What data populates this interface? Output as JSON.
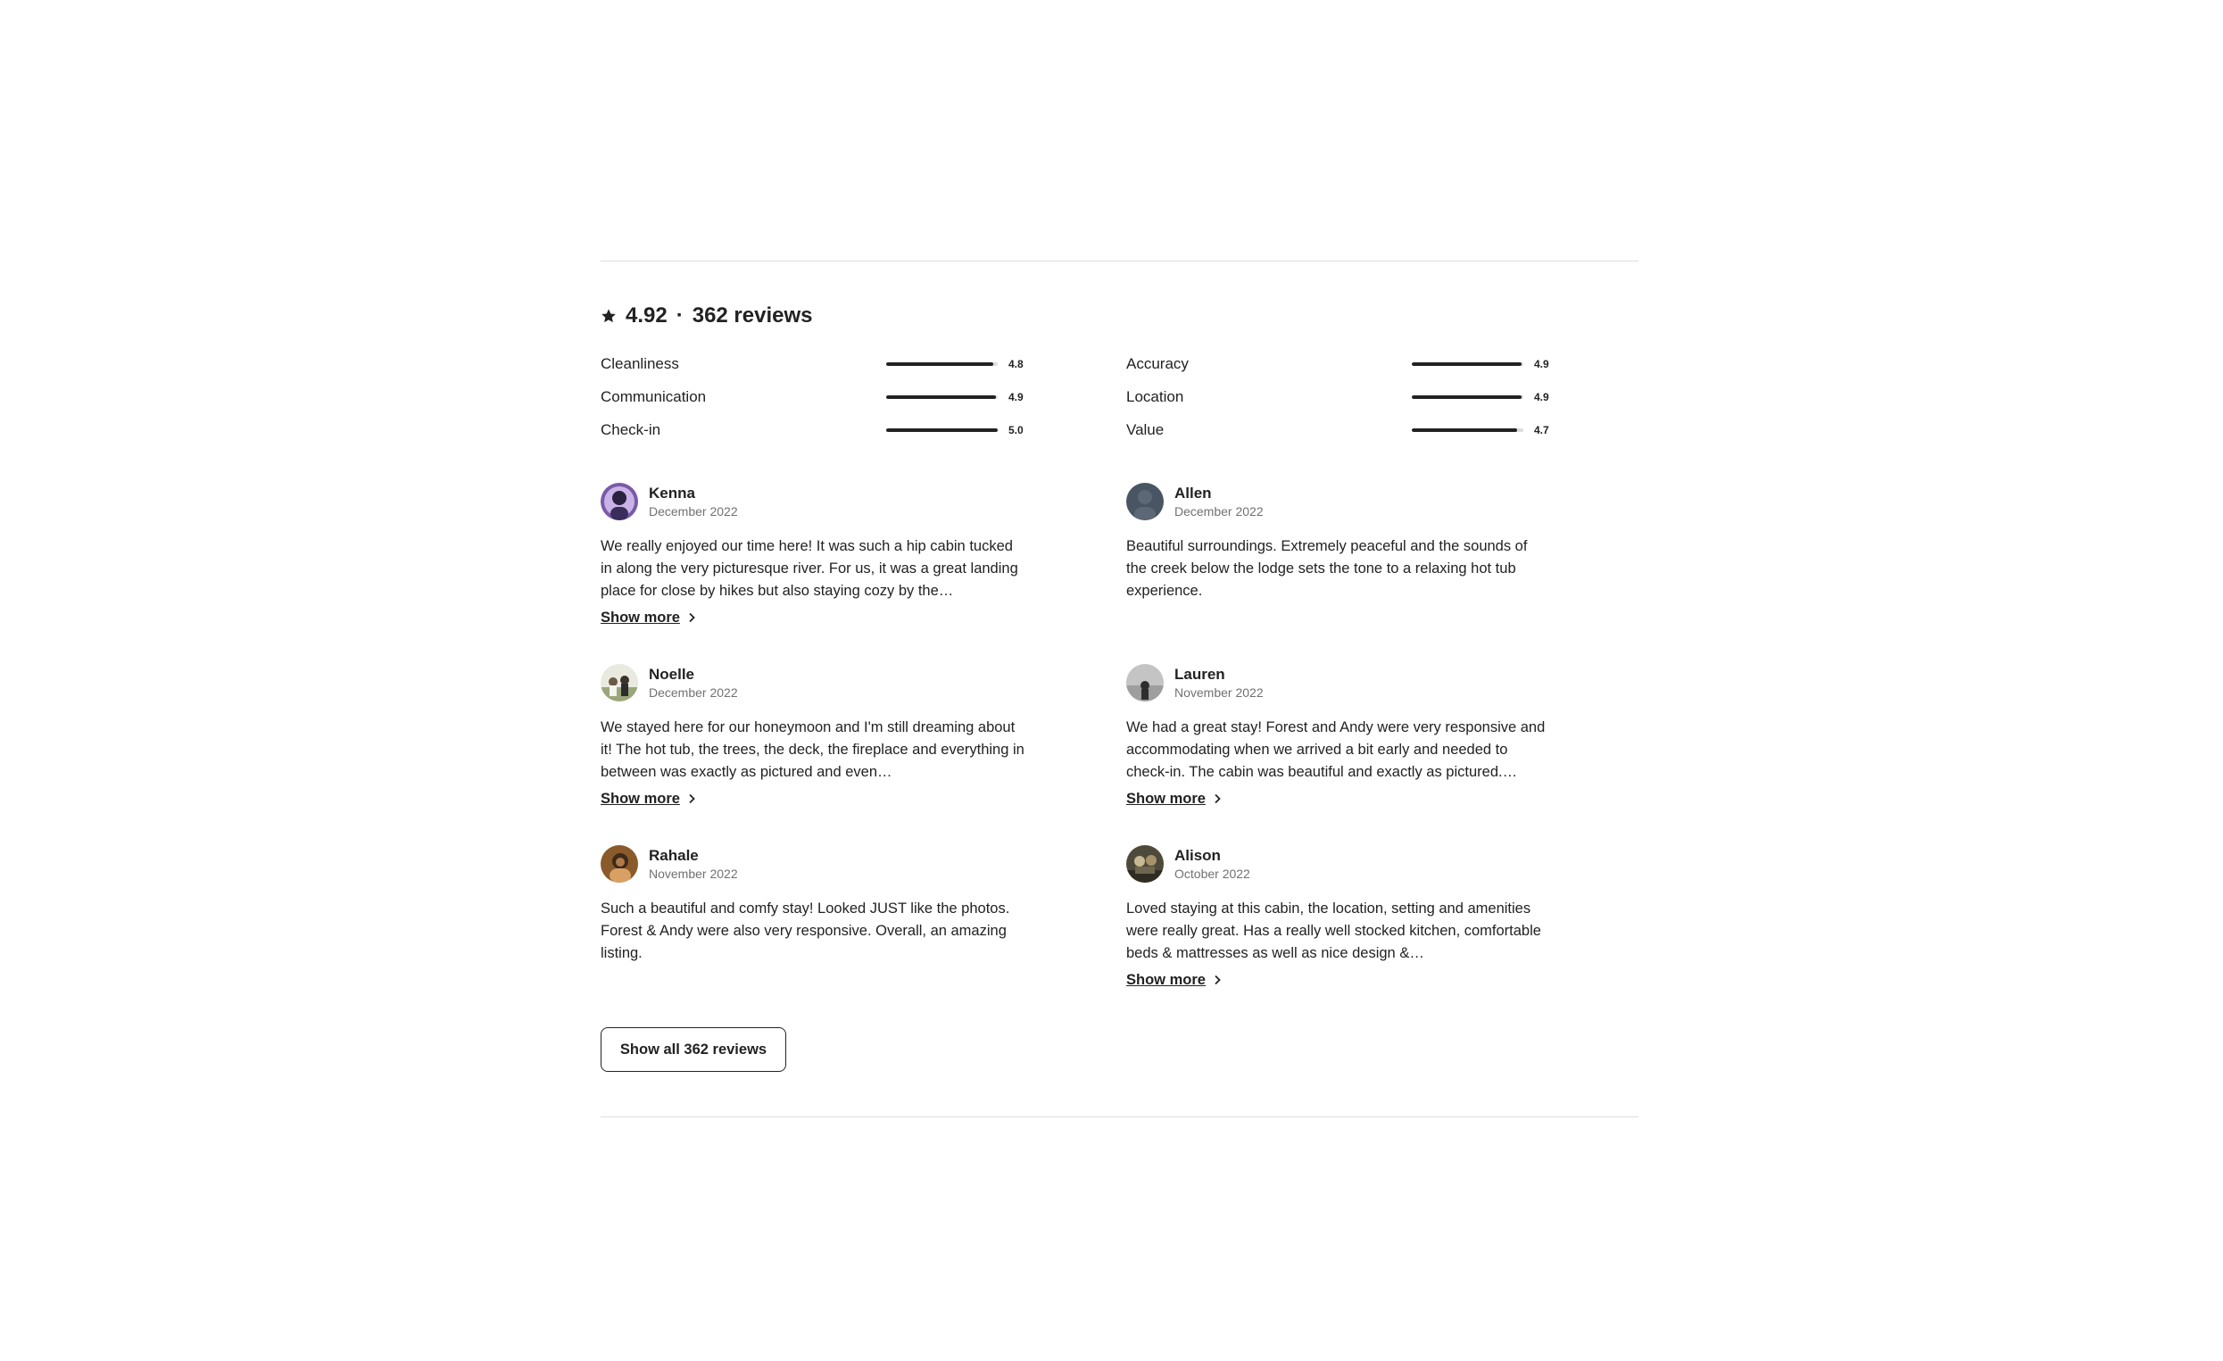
{
  "summary": {
    "rating": "4.92",
    "separator": "·",
    "reviews_label": "362 reviews"
  },
  "ratings": [
    {
      "label": "Cleanliness",
      "value": "4.8",
      "fraction": 0.96
    },
    {
      "label": "Accuracy",
      "value": "4.9",
      "fraction": 0.98
    },
    {
      "label": "Communication",
      "value": "4.9",
      "fraction": 0.98
    },
    {
      "label": "Location",
      "value": "4.9",
      "fraction": 0.98
    },
    {
      "label": "Check-in",
      "value": "5.0",
      "fraction": 1.0
    },
    {
      "label": "Value",
      "value": "4.7",
      "fraction": 0.94
    }
  ],
  "reviews": [
    {
      "name": "Kenna",
      "date": "December 2022",
      "text": "We really enjoyed our time here! It was such a hip cabin tucked in along the very picturesque river. For us, it was a great landing place for close by hikes but also staying cozy by the…",
      "show_more": "Show more",
      "avatar": "kenna-avatar"
    },
    {
      "name": "Allen",
      "date": "December 2022",
      "text": "Beautiful surroundings. Extremely peaceful and the sounds of the creek below the lodge sets the tone to a relaxing hot tub experience.",
      "show_more": "",
      "avatar": "allen-avatar"
    },
    {
      "name": "Noelle",
      "date": "December 2022",
      "text": "We stayed here for our honeymoon and I'm still dreaming about it! The hot tub, the trees, the deck, the fireplace and everything in between was exactly as pictured and even…",
      "show_more": "Show more",
      "avatar": "noelle-avatar"
    },
    {
      "name": "Lauren",
      "date": "November 2022",
      "text": "We had a great stay! Forest and Andy were very responsive and accommodating when we arrived a bit early and needed to check-in. The cabin was beautiful and exactly as pictured.…",
      "show_more": "Show more",
      "avatar": "lauren-avatar"
    },
    {
      "name": "Rahale",
      "date": "November 2022",
      "text": "Such a beautiful and comfy stay! Looked JUST like the photos. Forest & Andy were also very responsive. Overall, an amazing listing.",
      "show_more": "",
      "avatar": "rahale-avatar"
    },
    {
      "name": "Alison",
      "date": "October 2022",
      "text": "Loved staying at this cabin, the location, setting and amenities were really great. Has a really well stocked kitchen, comfortable beds & mattresses as well as nice design &…",
      "show_more": "Show more",
      "avatar": "alison-avatar"
    }
  ],
  "show_all_label": "Show all 362 reviews",
  "icons": {
    "star": "star-icon",
    "chevron": "chevron-right-icon"
  },
  "colors": {
    "text": "#222222",
    "muted": "#717171",
    "divider": "#dddddd"
  }
}
